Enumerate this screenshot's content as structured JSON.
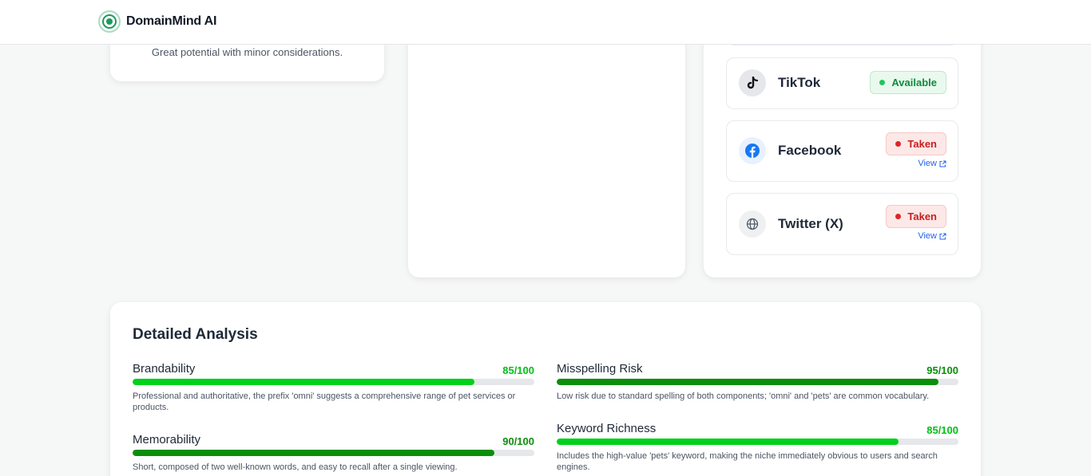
{
  "header": {
    "brand": "DomainMind AI"
  },
  "verdict": {
    "text": "Great potential with minor considerations."
  },
  "social": [
    {
      "name": "TikTok",
      "status": "Available",
      "icon": "tiktok-icon"
    },
    {
      "name": "Facebook",
      "status": "Taken",
      "link": "View",
      "icon": "facebook-icon"
    },
    {
      "name": "Twitter (X)",
      "status": "Taken",
      "link": "View",
      "icon": "globe-icon"
    }
  ],
  "analysis": {
    "title": "Detailed Analysis",
    "metrics": [
      {
        "name": "Brandability",
        "score": "85/100",
        "value": 0.85,
        "desc": "Professional and authoritative, the prefix 'omni' suggests a comprehensive range of pet services or products."
      },
      {
        "name": "Misspelling Risk",
        "score": "95/100",
        "value": 0.95,
        "desc": "Low risk due to standard spelling of both components; 'omni' and 'pets' are common vocabulary."
      },
      {
        "name": "Memorability",
        "score": "90/100",
        "value": 0.9,
        "desc": "Short, composed of two well-known words, and easy to recall after a single viewing."
      },
      {
        "name": "Keyword Richness",
        "score": "85/100",
        "value": 0.85,
        "desc": "Includes the high-value 'pets' keyword, making the niche immediately obvious to users and search engines."
      }
    ]
  },
  "colors": {
    "bright_green": "#00d119",
    "dark_green": "#0a8f0a",
    "available_green": "#128a3c",
    "taken_red": "#c81e1e",
    "link_blue": "#2563eb"
  }
}
